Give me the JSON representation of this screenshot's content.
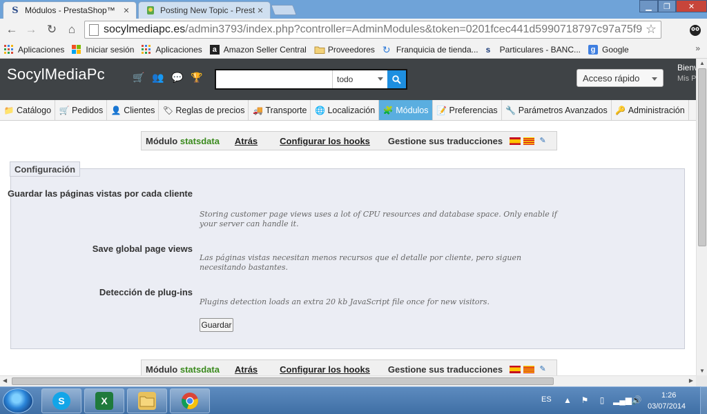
{
  "browser": {
    "tabs": [
      {
        "label": "Módulos - PrestaShop™",
        "active": true,
        "close": "✕"
      },
      {
        "label": "Posting New Topic - Prest",
        "active": false,
        "close": "✕"
      }
    ],
    "url": {
      "domain": "socylmediapc.es",
      "path": "/admin3793/index.php?controller=AdminModules&token=0201fcec441d5990718797c97a75f9"
    },
    "bookmarks": [
      {
        "label": "Aplicaciones",
        "icon": "apps-grid-icon"
      },
      {
        "label": "Iniciar sesión",
        "icon": "windows-icon"
      },
      {
        "label": "Aplicaciones",
        "icon": "apps-grid-icon"
      },
      {
        "label": "Amazon Seller Central",
        "icon": "amazon-icon"
      },
      {
        "label": "Proveedores",
        "icon": "folder-icon"
      },
      {
        "label": "Franquicia de tienda...",
        "icon": "refresh-icon"
      },
      {
        "label": "Particulares - BANC...",
        "icon": "bank-icon"
      },
      {
        "label": "Google",
        "icon": "google-icon"
      }
    ],
    "bookmarks_more": "»"
  },
  "header": {
    "logo": "SocylMediaPc",
    "search_scope": "todo",
    "quick_access": "Acceso rápido",
    "welcome": "Bienvenido",
    "my_prefs": "Mis Preferencias"
  },
  "menu": [
    {
      "label": "Catálogo",
      "icon": "folder-icon",
      "active": false
    },
    {
      "label": "Pedidos",
      "icon": "cart-icon",
      "active": false
    },
    {
      "label": "Clientes",
      "icon": "user-icon",
      "active": false
    },
    {
      "label": "Reglas de precios",
      "icon": "tag-icon",
      "active": false
    },
    {
      "label": "Transporte",
      "icon": "truck-icon",
      "active": false
    },
    {
      "label": "Localización",
      "icon": "globe-icon",
      "active": false
    },
    {
      "label": "Módulos",
      "icon": "puzzle-icon",
      "active": true
    },
    {
      "label": "Preferencias",
      "icon": "preferences-icon",
      "active": false
    },
    {
      "label": "Parámetros Avanzados",
      "icon": "wrench-icon",
      "active": false
    },
    {
      "label": "Administración",
      "icon": "key-icon",
      "active": false
    }
  ],
  "module_toolbar": {
    "prefix": "Módulo",
    "module_name": "statsdata",
    "back": "Atrás",
    "hooks": "Configurar los hooks",
    "translations": "Gestione sus traducciones"
  },
  "config": {
    "legend": "Configuración",
    "rows": [
      {
        "label": "Guardar las páginas vistas por cada cliente",
        "help": "Storing customer page views uses a lot of CPU resources and database space. Only enable if your server can handle it."
      },
      {
        "label": "Save global page views",
        "help": "Las páginas vistas necesitan menos recursos que el detalle por cliente, pero siguen necesitando bastantes."
      },
      {
        "label": "Detección de plug-ins",
        "help": "Plugins detection loads an extra 20 kb JavaScript file once for new visitors."
      }
    ],
    "save_label": "Guardar"
  },
  "taskbar": {
    "lang": "ES",
    "time": "1:26",
    "date": "03/07/2014"
  },
  "colors": {
    "header_bg": "#3f4346",
    "active_menu": "#5aaee0",
    "module_name": "#3a8a1d",
    "search_button": "#1e8fe0"
  }
}
